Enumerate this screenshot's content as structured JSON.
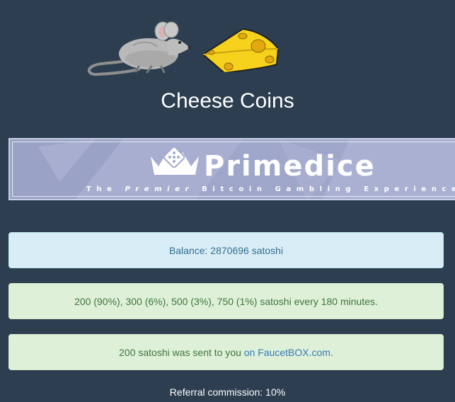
{
  "header": {
    "title": "Cheese Coins",
    "logo_icons": [
      "mouse-icon",
      "cheese-icon"
    ]
  },
  "banner": {
    "brand": "Primedice",
    "tagline_parts": [
      "The ",
      "Premier",
      " Bitcoin Gambling Experience"
    ],
    "icon": "crown-dice-icon"
  },
  "alerts": {
    "balance": "Balance: 2870696 satoshi",
    "rewards": "200 (90%), 300 (6%), 500 (3%), 750 (1%) satoshi every 180 minutes.",
    "sent_prefix": "200 satoshi was sent to you ",
    "sent_link": "on FaucetBOX.com",
    "sent_suffix": "."
  },
  "footer": {
    "referral": "Referral commission: 10%"
  },
  "colors": {
    "background": "#2c3e50",
    "info": "#d9edf7",
    "success": "#dff0d8",
    "banner": "#a2aacd"
  }
}
